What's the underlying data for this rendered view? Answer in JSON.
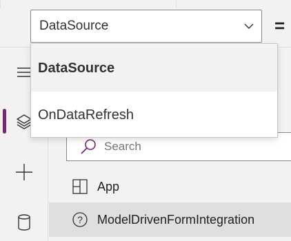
{
  "formula_bar": {
    "property_selected": "DataSource",
    "equals_sign": "="
  },
  "property_dropdown": {
    "options": [
      {
        "label": "DataSource",
        "selected": true
      },
      {
        "label": "OnDataRefresh",
        "selected": false
      }
    ]
  },
  "rail": {
    "items": [
      {
        "icon": "hamburger-icon"
      },
      {
        "icon": "layers-icon",
        "active": true
      },
      {
        "icon": "plus-icon"
      },
      {
        "icon": "database-icon"
      }
    ]
  },
  "tree_view": {
    "search": {
      "placeholder": "Search",
      "value": ""
    },
    "items": [
      {
        "label": "App",
        "icon": "app-grid-icon",
        "selected": false
      },
      {
        "label": "ModelDrivenFormIntegration",
        "icon": "help-circle-icon",
        "selected": true
      }
    ]
  },
  "colors": {
    "accent": "#742774",
    "background": "#f3f2f1",
    "selected_row": "#e1dfdd"
  }
}
